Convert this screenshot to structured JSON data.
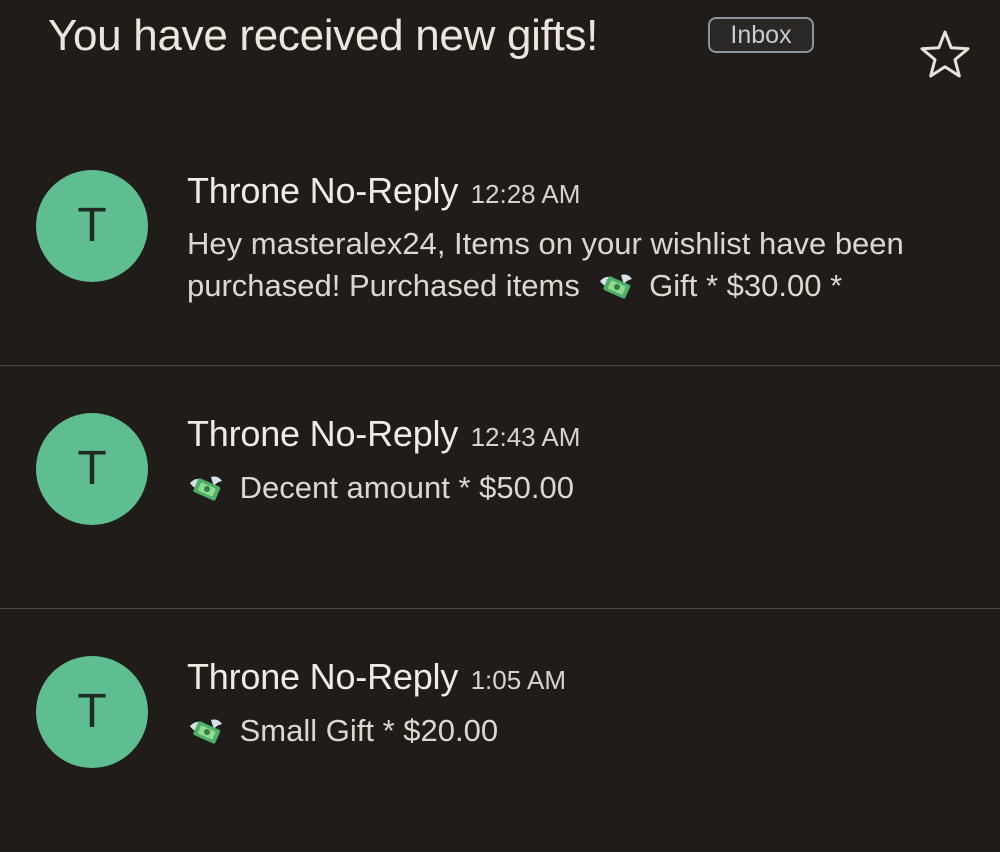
{
  "thread": {
    "subject": "You have received new gifts!",
    "label": "Inbox",
    "star_icon": "star-outline-icon"
  },
  "messages": [
    {
      "avatar_letter": "T",
      "sender": "Throne No-Reply",
      "time": "12:28 AM",
      "snippet_line1": "Hey masteralex24, Items on your wishlist have been",
      "snippet_line2_prefix": "purchased! Purchased items",
      "snippet_line2_suffix": "Gift * $30.00 *",
      "icon": "money-with-wings-icon"
    },
    {
      "avatar_letter": "T",
      "sender": "Throne No-Reply",
      "time": "12:43 AM",
      "snippet": "Decent amount * $50.00",
      "icon": "money-with-wings-icon"
    },
    {
      "avatar_letter": "T",
      "sender": "Throne No-Reply",
      "time": "1:05 AM",
      "snippet": "Small Gift * $20.00",
      "icon": "money-with-wings-icon"
    }
  ],
  "colors": {
    "background": "#201c1a",
    "avatar": "#5fbe8f",
    "text": "#ece6df",
    "chip_border": "#8d939b"
  }
}
